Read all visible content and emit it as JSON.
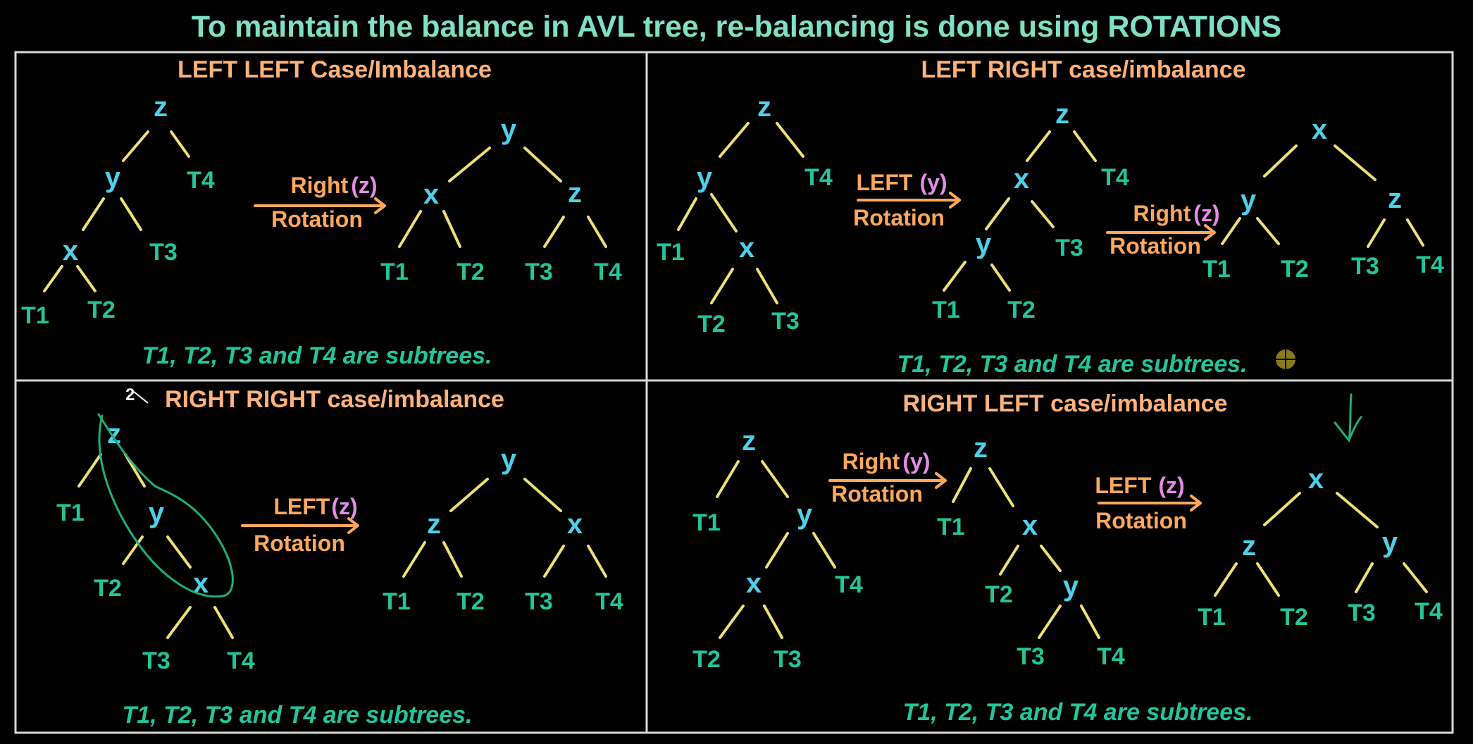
{
  "title": "To maintain the balance in AVL tree, re-balancing is done using ROTATIONS",
  "panels": {
    "ll": {
      "heading": "LEFT LEFT Case/Imbalance",
      "n": {
        "z": "z",
        "y": "y",
        "x": "x",
        "T1": "T1",
        "T2": "T2",
        "T3": "T3",
        "T4": "T4"
      },
      "step1": {
        "op": "Right",
        "param": "(z)",
        "rot": "Rotation"
      },
      "r": {
        "y": "y",
        "x": "x",
        "z": "z",
        "T1": "T1",
        "T2": "T2",
        "T3": "T3",
        "T4": "T4"
      },
      "note": "T1, T2, T3 and T4 are subtrees."
    },
    "lr": {
      "heading": "LEFT RIGHT case/imbalance",
      "n": {
        "z": "z",
        "y": "y",
        "x": "x",
        "T1": "T1",
        "T2": "T2",
        "T3": "T3",
        "T4": "T4"
      },
      "step1": {
        "op": "LEFT",
        "param": "(y)",
        "rot": "Rotation"
      },
      "m": {
        "z": "z",
        "x": "x",
        "y": "y",
        "T1": "T1",
        "T2": "T2",
        "T3": "T3",
        "T4": "T4"
      },
      "step2": {
        "op": "Right",
        "param": "(z)",
        "rot": "Rotation"
      },
      "r": {
        "x": "x",
        "y": "y",
        "z": "z",
        "T1": "T1",
        "T2": "T2",
        "T3": "T3",
        "T4": "T4"
      },
      "note": "T1, T2, T3 and T4 are subtrees."
    },
    "rr": {
      "heading": "RIGHT RIGHT case/imbalance",
      "mark": "2",
      "n": {
        "z": "z",
        "y": "y",
        "x": "x",
        "T1": "T1",
        "T2": "T2",
        "T3": "T3",
        "T4": "T4"
      },
      "step1": {
        "op": "LEFT",
        "param": "(z)",
        "rot": "Rotation"
      },
      "r": {
        "y": "y",
        "z": "z",
        "x": "x",
        "T1": "T1",
        "T2": "T2",
        "T3": "T3",
        "T4": "T4"
      },
      "note": "T1, T2, T3 and T4 are subtrees."
    },
    "rl": {
      "heading": "RIGHT LEFT case/imbalance",
      "n": {
        "z": "z",
        "y": "y",
        "x": "x",
        "T1": "T1",
        "T2": "T2",
        "T3": "T3",
        "T4": "T4"
      },
      "step1": {
        "op": "Right",
        "param": "(y)",
        "rot": "Rotation"
      },
      "m": {
        "z": "z",
        "x": "x",
        "y": "y",
        "T1": "T1",
        "T2": "T2",
        "T3": "T3",
        "T4": "T4"
      },
      "step2": {
        "op": "LEFT",
        "param": "(z)",
        "rot": "Rotation"
      },
      "r": {
        "x": "x",
        "z": "z",
        "y": "y",
        "T1": "T1",
        "T2": "T2",
        "T3": "T3",
        "T4": "T4"
      },
      "note": "T1, T2, T3 and T4 are subtrees."
    }
  },
  "colors": {
    "background": "#000000",
    "title": "#7fe0c4",
    "heading": "#ffb27a",
    "node": "#4fd0ea",
    "subtree": "#23c59a",
    "edge": "#efe074",
    "operation": "#ffa85a",
    "parameter": "#e58ce8",
    "annotation": "#1fae79"
  }
}
